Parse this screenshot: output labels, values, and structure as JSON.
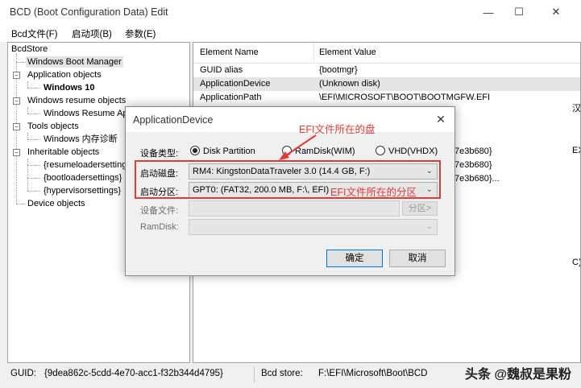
{
  "window": {
    "title": "BCD (Boot Configuration Data) Edit",
    "minimize_glyph": "—",
    "maximize_glyph": "☐",
    "close_glyph": "✕"
  },
  "menu": [
    "Bcd文件(F)",
    "启动项(B)",
    "参数(E)"
  ],
  "tree": {
    "root": "BcdStore",
    "items": [
      "Windows Boot Manager",
      "Application objects",
      "Windows 10",
      "Windows resume objects",
      "Windows Resume Application",
      "Tools objects",
      "Windows 内存诊断",
      "Inheritable objects",
      "{resumeloadersettings}",
      "{bootloadersettings}",
      "{hypervisorsettings}",
      "Device objects"
    ]
  },
  "properties": {
    "headers": [
      "Element Name",
      "Element Value"
    ],
    "rows": [
      {
        "name": "GUID alias",
        "value": "{bootmgr}"
      },
      {
        "name": "ApplicationDevice",
        "value": "(Unknown disk)"
      },
      {
        "name": "ApplicationPath",
        "value": "\\EFI\\MICROSOFT\\BOOT\\BOOTMGFW.EFI"
      }
    ],
    "partial_values": [
      "7e3b680}",
      "7e3b680}",
      "7e3b680}..."
    ],
    "right_edge_fragments": [
      "汉",
      "EX",
      "C)"
    ]
  },
  "status": {
    "guid_label": "GUID:",
    "guid_value": "{9dea862c-5cdd-4e70-acc1-f32b344d4795}",
    "store_label": "Bcd store:",
    "store_value": "F:\\EFI\\Microsoft\\Boot\\BCD"
  },
  "watermark": "头条 @魏叔是果粉",
  "dialog": {
    "title": "ApplicationDevice",
    "close_glyph": "✕",
    "device_type_label": "设备类型:",
    "radios": [
      {
        "label": "Disk Partition",
        "checked": true
      },
      {
        "label": "RamDisk(WIM)",
        "checked": false
      },
      {
        "label": "VHD(VHDX)",
        "checked": false
      }
    ],
    "boot_disk_label": "启动磁盘:",
    "boot_disk_value": "RM4: KingstonDataTraveler 3.0 (14.4 GB, F:)",
    "boot_partition_label": "启动分区:",
    "boot_partition_value": "GPT0: (FAT32, 200.0 MB, F:\\, EFI)",
    "device_file_label": "设备文件:",
    "partition_button": "分区>",
    "ramdisk_label": "RamDisk:",
    "ok_button": "确定",
    "cancel_button": "取消"
  },
  "annotations": {
    "efi_disk": "EFI文件所在的盘",
    "efi_partition": "EFI文件所在的分区",
    "color": "#e53935"
  }
}
